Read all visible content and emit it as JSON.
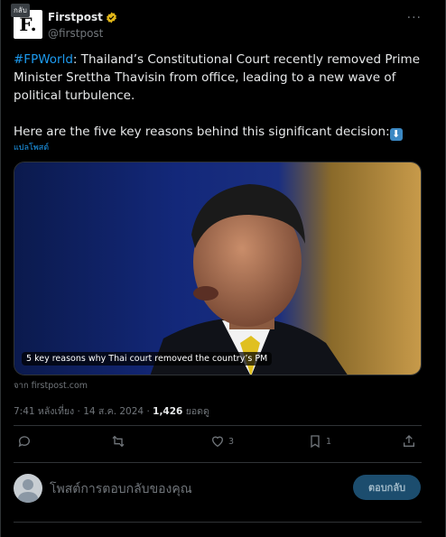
{
  "back_tab": "กลับ",
  "author": {
    "name": "Firstpost",
    "handle": "@firstpost",
    "avatar_letter": "F."
  },
  "tweet": {
    "hashtag": "#FPWorld",
    "body_1": ": Thailand’s Constitutional Court recently removed Prime Minister Srettha Thavisin from office, leading to a new wave of political turbulence.",
    "body_2": "Here are the five key reasons behind this significant decision:",
    "emoji": "⬇"
  },
  "translate_label": "แปลโพสต์",
  "card": {
    "caption": "5 key reasons why Thai court removed the country’s PM",
    "source": "จาก firstpost.com"
  },
  "meta": {
    "time": "7:41 หลังเที่ยง",
    "separator": "·",
    "date": "14 ส.ค. 2024",
    "views_count": "1,426",
    "views_label": "ยอดดู"
  },
  "actions": {
    "reply_count": "",
    "retweet_count": "",
    "like_count": "3",
    "bookmark_count": "1"
  },
  "reply": {
    "placeholder": "โพสต์การตอบกลับของคุณ",
    "button_label": "ตอบกลับ"
  },
  "colors": {
    "accent": "#1d9bf0",
    "verified": "#e2b719",
    "background": "#000000"
  }
}
